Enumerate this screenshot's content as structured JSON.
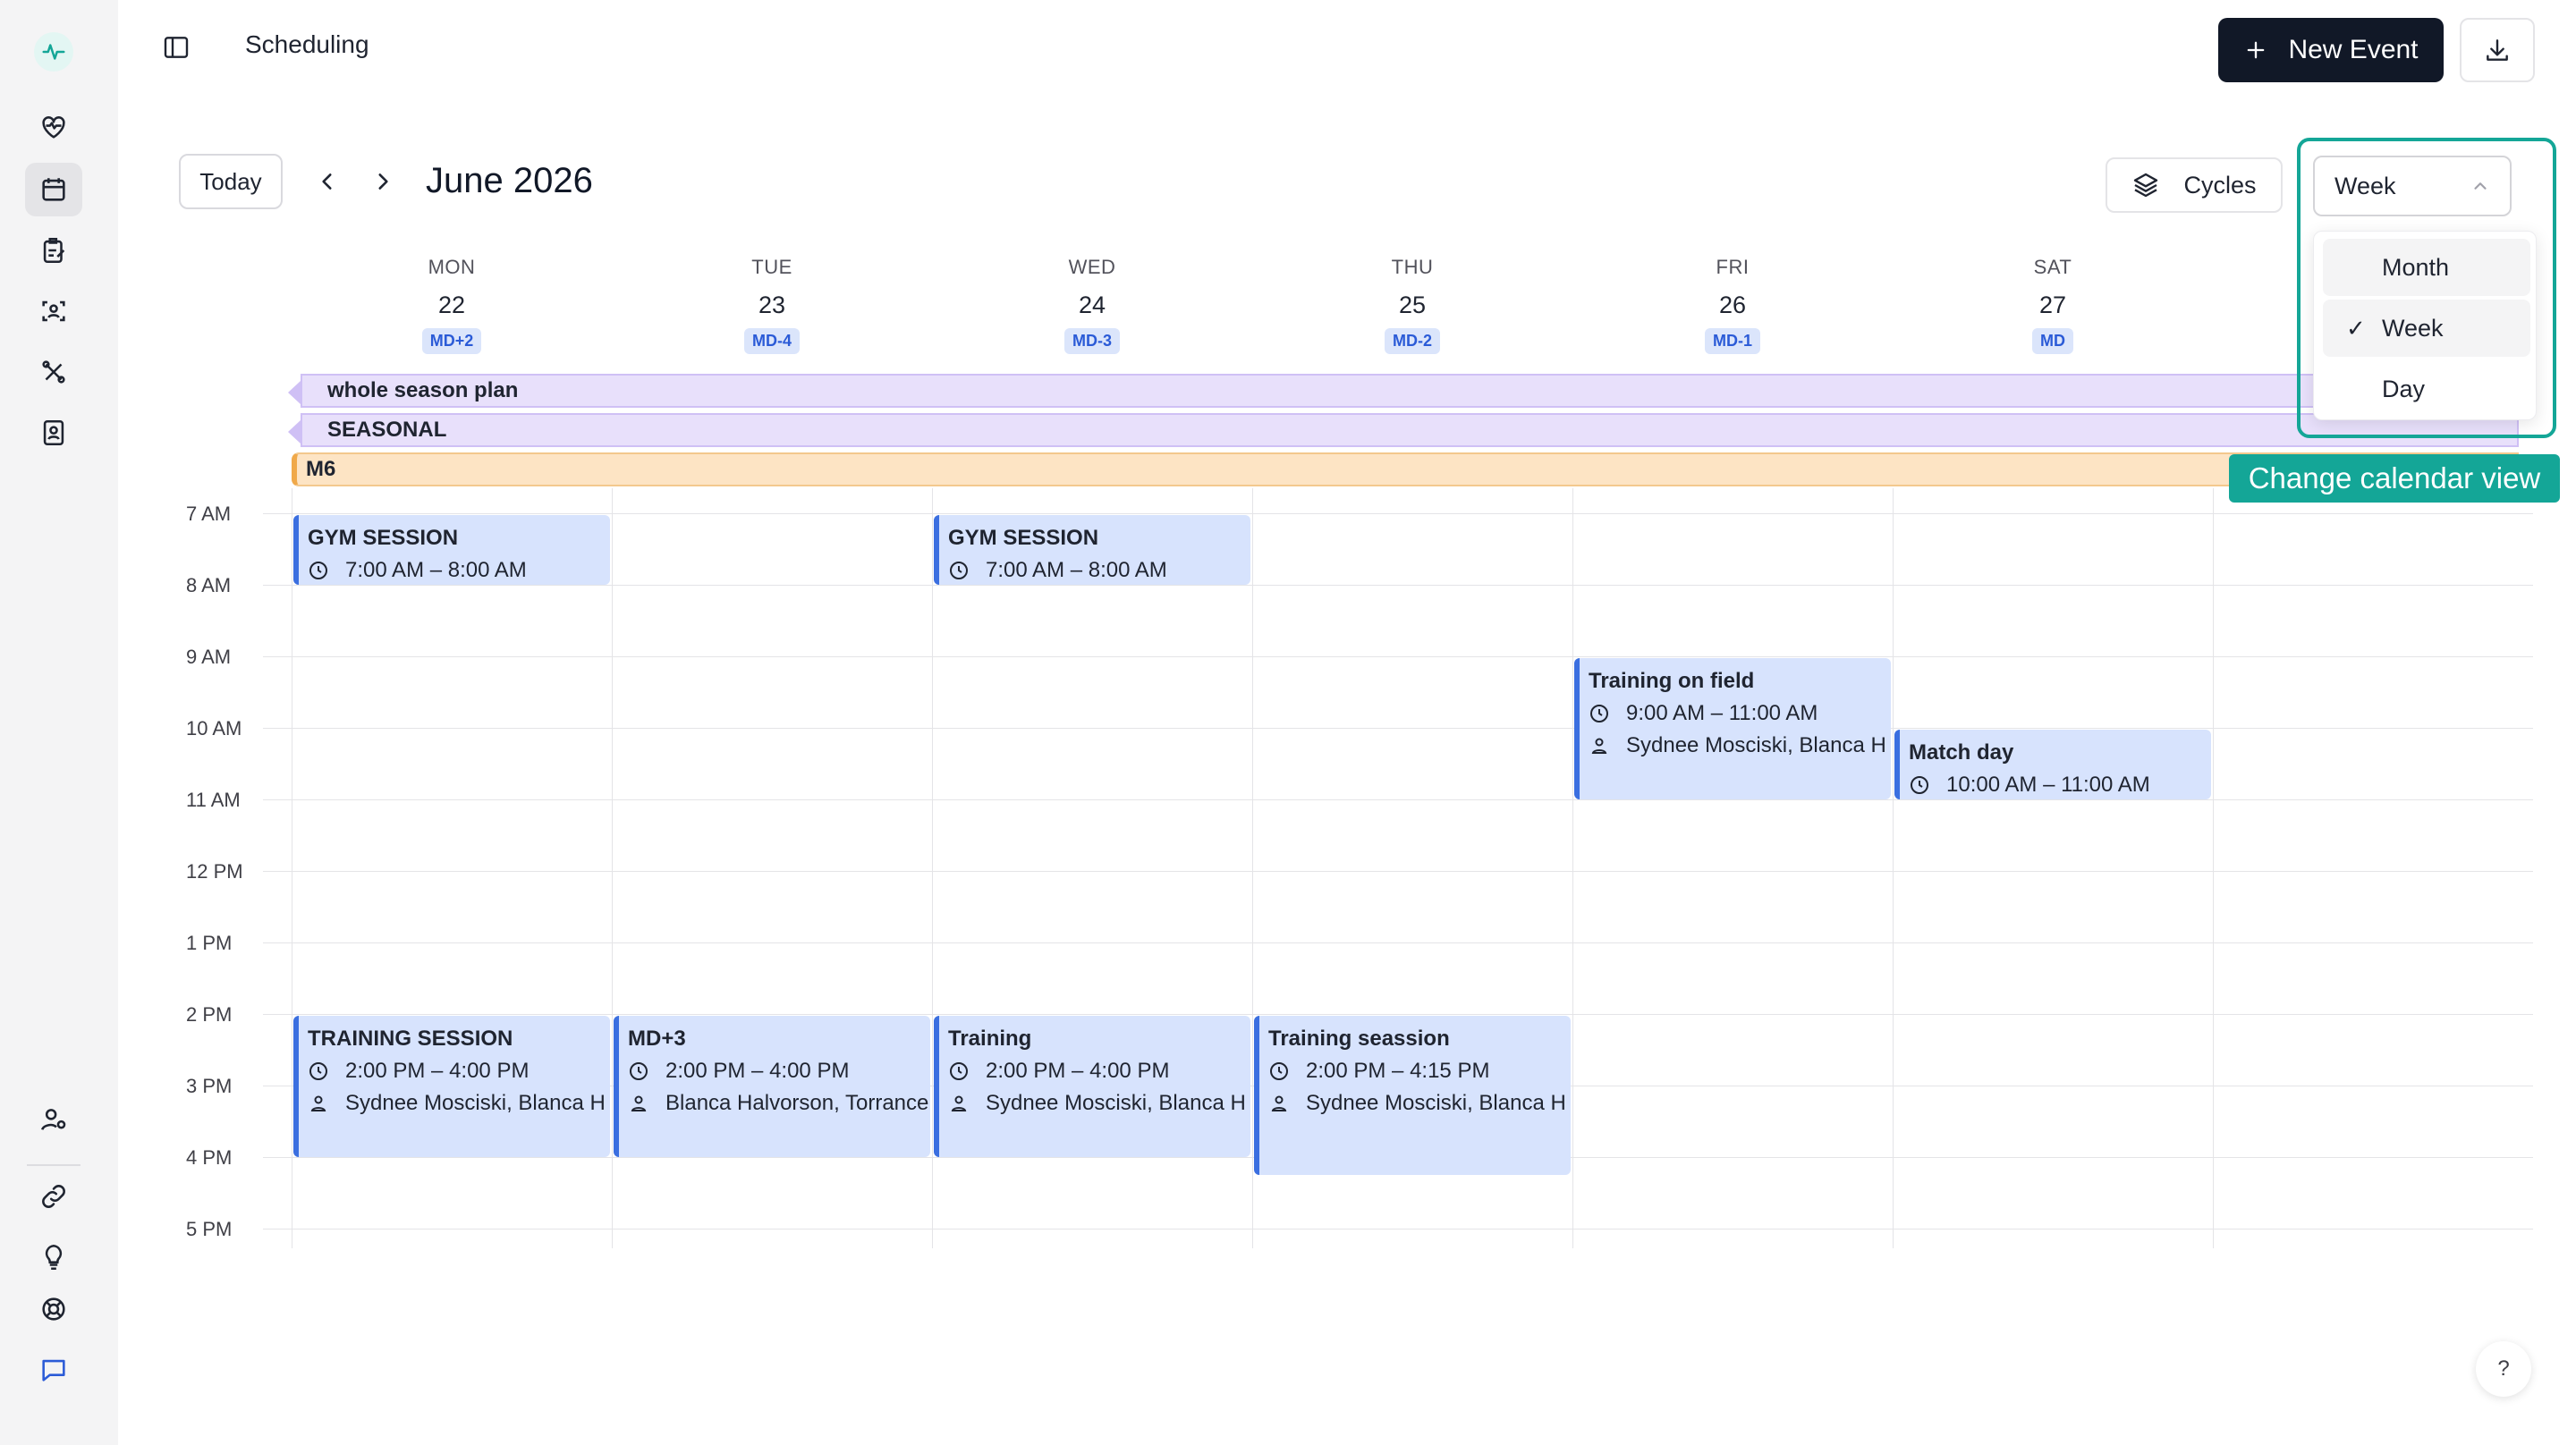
{
  "header": {
    "title": "Scheduling",
    "new_event_label": "New Event"
  },
  "toolbar": {
    "today_label": "Today",
    "month_label": "June 2026",
    "cycles_label": "Cycles",
    "view_selected": "Week"
  },
  "view_dropdown": {
    "items": [
      "Month",
      "Week",
      "Day"
    ],
    "selected": "Week",
    "check": "✓",
    "tooltip": "Change calendar view"
  },
  "days": [
    {
      "name": "MON",
      "num": "22",
      "tag": "MD+2"
    },
    {
      "name": "TUE",
      "num": "23",
      "tag": "MD-4"
    },
    {
      "name": "WED",
      "num": "24",
      "tag": "MD-3"
    },
    {
      "name": "THU",
      "num": "25",
      "tag": "MD-2"
    },
    {
      "name": "FRI",
      "num": "26",
      "tag": "MD-1"
    },
    {
      "name": "SAT",
      "num": "27",
      "tag": "MD"
    }
  ],
  "allday": [
    "whole season plan",
    "SEASONAL",
    "M6"
  ],
  "times": [
    "7 AM",
    "8 AM",
    "9 AM",
    "10 AM",
    "11 AM",
    "12 PM",
    "1 PM",
    "2 PM",
    "3 PM",
    "4 PM",
    "5 PM"
  ],
  "events": [
    {
      "title": "GYM SESSION",
      "time": "7:00 AM – 8:00 AM",
      "people": ""
    },
    {
      "title": "GYM SESSION",
      "time": "7:00 AM – 8:00 AM",
      "people": ""
    },
    {
      "title": "Training on field",
      "time": "9:00 AM – 11:00 AM",
      "people": "Sydnee Mosciski, Blanca H"
    },
    {
      "title": "Match day",
      "time": "10:00 AM – 11:00 AM",
      "people": ""
    },
    {
      "title": "TRAINING SESSION",
      "time": "2:00 PM – 4:00 PM",
      "people": "Sydnee Mosciski, Blanca H"
    },
    {
      "title": "MD+3",
      "time": "2:00 PM – 4:00 PM",
      "people": "Blanca Halvorson, Torrance"
    },
    {
      "title": "Training",
      "time": "2:00 PM – 4:00 PM",
      "people": "Sydnee Mosciski, Blanca H"
    },
    {
      "title": "Training seassion",
      "time": "2:00 PM – 4:15 PM",
      "people": "Sydnee Mosciski, Blanca H"
    }
  ],
  "help_label": "?",
  "colors": {
    "accent": "#14a697",
    "event_bg": "#d7e3fd",
    "event_border": "#3b6fe0",
    "season_bg": "#e8e0fb",
    "m6_bg": "#fde4c4"
  },
  "icons": [
    "pulse-logo-icon",
    "heart-pulse-icon",
    "calendar-icon",
    "clipboard-icon",
    "scan-user-icon",
    "drill-icon",
    "id-card-icon",
    "user-settings-icon",
    "link-icon",
    "lightbulb-icon",
    "lifebuoy-icon",
    "chat-icon",
    "sidebar-toggle-icon",
    "plus-icon",
    "download-icon",
    "chevron-left-icon",
    "chevron-right-icon",
    "layers-icon",
    "chevron-up-icon",
    "clock-icon",
    "person-icon"
  ]
}
